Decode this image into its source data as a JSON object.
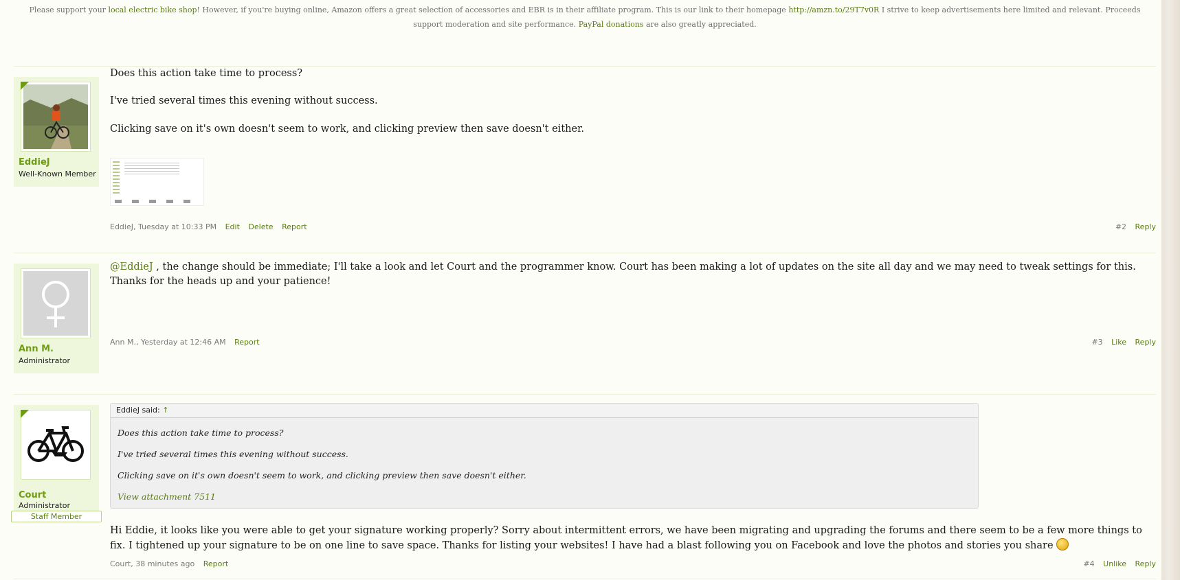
{
  "notice": {
    "t1": "Please support your ",
    "link1": "local electric bike shop",
    "t2": "! However, if you're buying online, Amazon offers a great selection of accessories and EBR is in their affiliate program. This is our link to their homepage ",
    "link2": "http://amzn.to/29T7v0R",
    "t3": " I strive to keep advertisements here limited and relevant. Proceeds support moderation and site performance. ",
    "link3": "PayPal donations",
    "t4": " are also greatly appreciated."
  },
  "posts": [
    {
      "author": "EddieJ",
      "role": "Well-Known Member",
      "lines": [
        "Does this action take time to process?",
        "I've tried several times this evening without success.",
        "Clicking save on it's own doesn't seem to work, and clicking preview then save doesn't either."
      ],
      "meta_author": "EddieJ",
      "meta_time": ", Tuesday at 10:33 PM",
      "actions": [
        "Edit",
        "Delete",
        "Report"
      ],
      "number": "#2",
      "right_actions": [
        "Reply"
      ]
    },
    {
      "author": "Ann M.",
      "role": "Administrator",
      "mention": "@EddieJ",
      "text": " , the change should be immediate; I'll take a look and let Court and the programmer know. Court has been making a lot of updates on the site all day and we may need to tweak settings for this. Thanks for the heads up and your patience!",
      "meta_author": "Ann M.",
      "meta_time": ", Yesterday at 12:46 AM",
      "actions": [
        "Report"
      ],
      "number": "#3",
      "right_actions": [
        "Like",
        "Reply"
      ]
    },
    {
      "author": "Court",
      "role": "Administrator",
      "badge": "Staff Member",
      "quote": {
        "header": "EddieJ said:",
        "arrow": "↑",
        "lines": [
          "Does this action take time to process?",
          "I've tried several times this evening without success.",
          "Clicking save on it's own doesn't seem to work, and clicking preview then save doesn't either."
        ],
        "attachment": "View attachment 7511"
      },
      "text": "Hi Eddie, it looks like you were able to get your signature working properly? Sorry about intermittent errors, we have been migrating and upgrading the forums and there seem to be a few more things to fix. I tightened up your signature to be on one line to save space. Thanks for listing your websites! I have had a blast following you on Facebook and love the photos and stories you share",
      "meta_author": "Court",
      "meta_time": ", 38 minutes ago",
      "actions": [
        "Report"
      ],
      "number": "#4",
      "right_actions": [
        "Unlike",
        "Reply"
      ]
    }
  ],
  "colors": {
    "accent": "#6f9d12",
    "link": "#5a7d0f",
    "background": "#fbfdf6",
    "userblock": "#eef6dc"
  },
  "icons": {
    "smiley": "smiley-icon",
    "avatar_default": "female-symbol-icon",
    "avatar_court": "bicycle-icon"
  }
}
